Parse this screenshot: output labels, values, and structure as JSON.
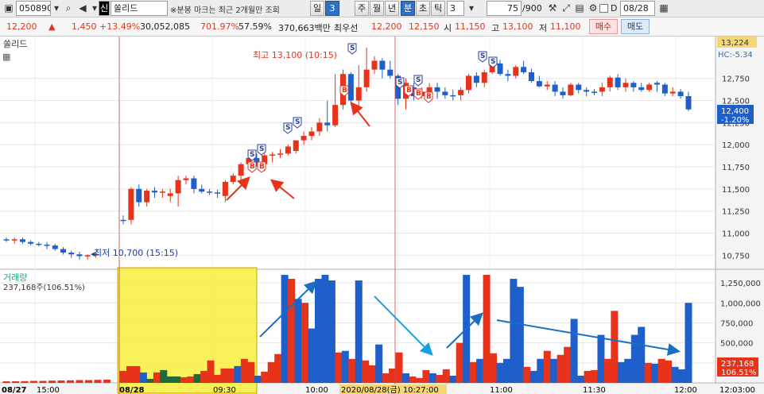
{
  "toolbar": {
    "code": "050890",
    "market_badge": "신",
    "stock_name": "쏠리드",
    "notice": "※분봉 마크는 최근 2개월만 조회",
    "periods": [
      "일",
      "3",
      "주",
      "월",
      "년",
      "분",
      "초",
      "틱"
    ],
    "selected_period": "분",
    "interval_value": "3",
    "count": "75",
    "count_total": "/900",
    "date_checkbox_label": "D",
    "date_value": "08/28"
  },
  "quote": {
    "price": "12,200",
    "change": "1,450",
    "change_pct": "+13.49%",
    "volume": "30,052,085",
    "volume_ratio": "701.97%",
    "turnover_ratio": "57.59%",
    "amount": "370,663백만",
    "best_bid_label": "최우선",
    "best_ask": "12,200",
    "best_bid": "12,150",
    "open_label": "시",
    "open": "11,150",
    "high_label": "고",
    "high": "13,100",
    "low_label": "저",
    "low": "11,100",
    "buy_label": "매수",
    "sell_label": "매도"
  },
  "price_panel": {
    "title": "쏠리드",
    "high_annotation": "최고 13,100 (10:15)",
    "low_annotation": "최저 10,700 (15:15)",
    "top_tag": "13,224",
    "hc_tag": "HC:-5.34",
    "current_tag": "12,400",
    "current_pct_tag": "-1.20%",
    "buy_marker": "B",
    "sell_marker": "S"
  },
  "volume_panel": {
    "title": "거래량",
    "legend_value": "237,168주(106.51%)",
    "current_tag": "237,168",
    "current_pct_tag": "106.51%"
  },
  "x_axis": {
    "labels": [
      "08/27",
      "15:00",
      "08/28",
      "09:30",
      "10:00",
      "10:30",
      "11:00",
      "11:30",
      "12:00",
      "12:03:00"
    ],
    "cursor_label": "2020/08/28(금) 10:27:00"
  },
  "chart_data": [
    {
      "type": "candlestick",
      "title": "쏠리드",
      "y_ticks": [
        10750,
        11000,
        11250,
        11500,
        11750,
        12000,
        12250,
        12500,
        12750
      ],
      "ylim": [
        10600,
        13224
      ],
      "colors": {
        "up": "#e8331b",
        "down": "#1f5fc9",
        "flat": "#1f5fc9"
      },
      "candles": [
        {
          "o": 10930,
          "h": 10950,
          "l": 10900,
          "c": 10920
        },
        {
          "o": 10920,
          "h": 10950,
          "l": 10880,
          "c": 10930
        },
        {
          "o": 10930,
          "h": 10950,
          "l": 10880,
          "c": 10900
        },
        {
          "o": 10900,
          "h": 10920,
          "l": 10860,
          "c": 10880
        },
        {
          "o": 10880,
          "h": 10900,
          "l": 10850,
          "c": 10870
        },
        {
          "o": 10870,
          "h": 10900,
          "l": 10820,
          "c": 10860
        },
        {
          "o": 10860,
          "h": 10880,
          "l": 10800,
          "c": 10820
        },
        {
          "o": 10820,
          "h": 10840,
          "l": 10760,
          "c": 10780
        },
        {
          "o": 10780,
          "h": 10800,
          "l": 10720,
          "c": 10760
        },
        {
          "o": 10760,
          "h": 10790,
          "l": 10700,
          "c": 10740
        },
        {
          "o": 10740,
          "h": 10760,
          "l": 10700,
          "c": 10750
        },
        {
          "o": 10750,
          "h": 10780,
          "l": 10720,
          "c": 10760
        },
        {
          "o": 11150,
          "h": 11200,
          "l": 11100,
          "c": 11150
        },
        {
          "o": 11150,
          "h": 11520,
          "l": 11100,
          "c": 11500
        },
        {
          "o": 11500,
          "h": 11550,
          "l": 11300,
          "c": 11350
        },
        {
          "o": 11350,
          "h": 11500,
          "l": 11300,
          "c": 11480
        },
        {
          "o": 11480,
          "h": 11520,
          "l": 11400,
          "c": 11460
        },
        {
          "o": 11460,
          "h": 11500,
          "l": 11400,
          "c": 11470
        },
        {
          "o": 11420,
          "h": 11500,
          "l": 11350,
          "c": 11450
        },
        {
          "o": 11450,
          "h": 11650,
          "l": 11300,
          "c": 11600
        },
        {
          "o": 11600,
          "h": 11650,
          "l": 11550,
          "c": 11620
        },
        {
          "o": 11620,
          "h": 11650,
          "l": 11450,
          "c": 11500
        },
        {
          "o": 11500,
          "h": 11550,
          "l": 11450,
          "c": 11470
        },
        {
          "o": 11470,
          "h": 11500,
          "l": 11430,
          "c": 11460
        },
        {
          "o": 11460,
          "h": 11490,
          "l": 11400,
          "c": 11460
        },
        {
          "o": 11420,
          "h": 11600,
          "l": 11350,
          "c": 11580
        },
        {
          "o": 11580,
          "h": 11680,
          "l": 11550,
          "c": 11650
        },
        {
          "o": 11650,
          "h": 11800,
          "l": 11600,
          "c": 11780
        },
        {
          "o": 11780,
          "h": 11880,
          "l": 11720,
          "c": 11850
        },
        {
          "o": 11850,
          "h": 11900,
          "l": 11750,
          "c": 11780
        },
        {
          "o": 11780,
          "h": 11900,
          "l": 11700,
          "c": 11880
        },
        {
          "o": 11880,
          "h": 11920,
          "l": 11800,
          "c": 11890
        },
        {
          "o": 11890,
          "h": 11950,
          "l": 11850,
          "c": 11900
        },
        {
          "o": 11900,
          "h": 12000,
          "l": 11880,
          "c": 11980
        },
        {
          "o": 11930,
          "h": 12050,
          "l": 11900,
          "c": 12050
        },
        {
          "o": 12050,
          "h": 12150,
          "l": 12000,
          "c": 12100
        },
        {
          "o": 12100,
          "h": 12200,
          "l": 12050,
          "c": 12150
        },
        {
          "o": 12150,
          "h": 12300,
          "l": 12100,
          "c": 12250
        },
        {
          "o": 12250,
          "h": 12500,
          "l": 12150,
          "c": 12220
        },
        {
          "o": 12220,
          "h": 12800,
          "l": 12200,
          "c": 12450
        },
        {
          "o": 12450,
          "h": 12850,
          "l": 12400,
          "c": 12800
        },
        {
          "o": 12800,
          "h": 12820,
          "l": 12450,
          "c": 12500
        },
        {
          "o": 12500,
          "h": 12900,
          "l": 12400,
          "c": 12650
        },
        {
          "o": 12650,
          "h": 13100,
          "l": 12600,
          "c": 12850
        },
        {
          "o": 12850,
          "h": 13000,
          "l": 12800,
          "c": 12950
        },
        {
          "o": 12950,
          "h": 12980,
          "l": 12750,
          "c": 12850
        },
        {
          "o": 12850,
          "h": 12950,
          "l": 12750,
          "c": 12780
        },
        {
          "o": 12780,
          "h": 12800,
          "l": 12450,
          "c": 12520
        },
        {
          "o": 12520,
          "h": 12750,
          "l": 12400,
          "c": 12700
        },
        {
          "o": 12650,
          "h": 12700,
          "l": 12500,
          "c": 12550
        },
        {
          "o": 12550,
          "h": 12650,
          "l": 12520,
          "c": 12600
        },
        {
          "o": 12600,
          "h": 12700,
          "l": 12550,
          "c": 12650
        },
        {
          "o": 12650,
          "h": 12700,
          "l": 12520,
          "c": 12600
        },
        {
          "o": 12600,
          "h": 12650,
          "l": 12520,
          "c": 12560
        },
        {
          "o": 12560,
          "h": 12620,
          "l": 12500,
          "c": 12560
        },
        {
          "o": 12560,
          "h": 12650,
          "l": 12500,
          "c": 12620
        },
        {
          "o": 12620,
          "h": 12800,
          "l": 12580,
          "c": 12780
        },
        {
          "o": 12780,
          "h": 12820,
          "l": 12650,
          "c": 12700
        },
        {
          "o": 12700,
          "h": 12850,
          "l": 12650,
          "c": 12820
        },
        {
          "o": 12820,
          "h": 12950,
          "l": 12800,
          "c": 12920
        },
        {
          "o": 12920,
          "h": 12960,
          "l": 12780,
          "c": 12800
        },
        {
          "o": 12800,
          "h": 12850,
          "l": 12720,
          "c": 12780
        },
        {
          "o": 12780,
          "h": 12900,
          "l": 12750,
          "c": 12880
        },
        {
          "o": 12880,
          "h": 12950,
          "l": 12800,
          "c": 12820
        },
        {
          "o": 12820,
          "h": 12860,
          "l": 12700,
          "c": 12720
        },
        {
          "o": 12720,
          "h": 12780,
          "l": 12650,
          "c": 12660
        },
        {
          "o": 12660,
          "h": 12720,
          "l": 12620,
          "c": 12680
        },
        {
          "o": 12680,
          "h": 12720,
          "l": 12550,
          "c": 12600
        },
        {
          "o": 12600,
          "h": 12650,
          "l": 12520,
          "c": 12560
        },
        {
          "o": 12560,
          "h": 12700,
          "l": 12550,
          "c": 12680
        },
        {
          "o": 12680,
          "h": 12700,
          "l": 12580,
          "c": 12620
        },
        {
          "o": 12620,
          "h": 12650,
          "l": 12550,
          "c": 12600
        },
        {
          "o": 12600,
          "h": 12630,
          "l": 12560,
          "c": 12600
        },
        {
          "o": 12600,
          "h": 12700,
          "l": 12550,
          "c": 12650
        },
        {
          "o": 12650,
          "h": 12780,
          "l": 12600,
          "c": 12760
        },
        {
          "o": 12760,
          "h": 12800,
          "l": 12620,
          "c": 12650
        },
        {
          "o": 12650,
          "h": 12750,
          "l": 12600,
          "c": 12700
        },
        {
          "o": 12700,
          "h": 12720,
          "l": 12600,
          "c": 12650
        },
        {
          "o": 12650,
          "h": 12700,
          "l": 12600,
          "c": 12620
        },
        {
          "o": 12620,
          "h": 12700,
          "l": 12600,
          "c": 12680
        },
        {
          "o": 12700,
          "h": 12720,
          "l": 12600,
          "c": 12680
        },
        {
          "o": 12680,
          "h": 12700,
          "l": 12550,
          "c": 12580
        },
        {
          "o": 12580,
          "h": 12650,
          "l": 12550,
          "c": 12600
        },
        {
          "o": 12600,
          "h": 12630,
          "l": 12520,
          "c": 12550
        },
        {
          "o": 12550,
          "h": 12600,
          "l": 12380,
          "c": 12400
        }
      ]
    },
    {
      "type": "bar",
      "title": "거래량",
      "y_ticks": [
        250000,
        500000,
        750000,
        1000000,
        1250000
      ],
      "ylim": [
        0,
        1350000
      ],
      "values": [
        20000,
        20000,
        22000,
        25000,
        25000,
        28000,
        30000,
        32000,
        35000,
        35000,
        38000,
        40000,
        150000,
        210000,
        210000,
        130000,
        50000,
        130000,
        160000,
        80000,
        80000,
        70000,
        80000,
        110000,
        150000,
        280000,
        100000,
        180000,
        180000,
        210000,
        300000,
        260000,
        90000,
        140000,
        260000,
        360000,
        1350000,
        1300000,
        1050000,
        1000000,
        680000,
        1300000,
        1350000,
        1280000,
        380000,
        400000,
        300000,
        1280000,
        280000,
        220000,
        480000,
        120000,
        180000,
        380000,
        120000,
        80000,
        60000,
        160000,
        120000,
        100000,
        170000,
        90000,
        500000,
        1350000,
        260000,
        300000,
        1350000,
        370000,
        250000,
        300000,
        1300000,
        1200000,
        200000,
        150000,
        300000,
        400000,
        300000,
        350000,
        450000,
        800000,
        90000,
        150000,
        160000,
        600000,
        300000,
        900000,
        260000,
        300000,
        600000,
        700000,
        250000,
        240000,
        300000,
        280000,
        200000,
        170000,
        1000000
      ],
      "colors": [
        "r",
        "r",
        "r",
        "r",
        "r",
        "r",
        "r",
        "r",
        "r",
        "r",
        "r",
        "r",
        "r",
        "r",
        "r",
        "b",
        "g",
        "r",
        "g",
        "g",
        "g",
        "r",
        "r",
        "g",
        "r",
        "r",
        "r",
        "r",
        "r",
        "b",
        "r",
        "r",
        "b",
        "r",
        "r",
        "r",
        "b",
        "r",
        "b",
        "r",
        "b",
        "b",
        "b",
        "b",
        "r",
        "b",
        "r",
        "b",
        "r",
        "r",
        "b",
        "r",
        "r",
        "r",
        "b",
        "r",
        "r",
        "r",
        "b",
        "r",
        "r",
        "b",
        "r",
        "b",
        "r",
        "b",
        "r",
        "r",
        "b",
        "b",
        "b",
        "b",
        "r",
        "b",
        "b",
        "r",
        "b",
        "r",
        "r",
        "b",
        "b",
        "r",
        "r",
        "b",
        "r",
        "r",
        "b",
        "b",
        "b",
        "b",
        "r",
        "b",
        "r",
        "r",
        "b",
        "b",
        "b",
        "b",
        "b",
        "b"
      ]
    }
  ]
}
